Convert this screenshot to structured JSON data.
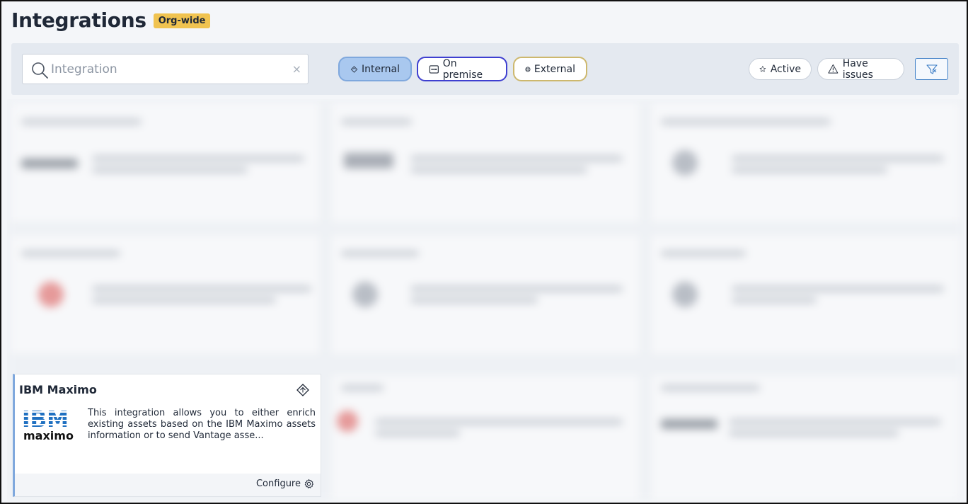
{
  "header": {
    "title": "Integrations",
    "badge": "Org-wide"
  },
  "toolbar": {
    "search": {
      "placeholder": "Integration",
      "value": "",
      "clear_icon": "×"
    },
    "type_filters": [
      {
        "label": "Internal",
        "icon": "diamond-icon",
        "selected": true,
        "color": "#a9c8ef"
      },
      {
        "label": "On premise",
        "icon": "server-icon",
        "selected": false,
        "color": "#3e3fd0"
      },
      {
        "label": "External",
        "icon": "globe-icon",
        "selected": false,
        "color": "#cdb86d"
      }
    ],
    "status_filters": [
      {
        "label": "Active",
        "icon": "star-icon"
      },
      {
        "label": "Have issues",
        "icon": "warning-icon"
      }
    ],
    "clear_filters_icon": "filter-clear-icon"
  },
  "cards": [
    {
      "name": "IBM Maximo",
      "logo": "ibm-maximo-logo",
      "logo_text": {
        "ibm": "IBM",
        "product": "maximo"
      },
      "description": "This integration allows you to either enrich existing assets based on the IBM Maximo assets information or to send Vantage asse...",
      "action": "Configure",
      "type_icon": "diamond-icon"
    }
  ],
  "colors": {
    "accent": "#3f7fc6",
    "badge": "#f0c350",
    "card_border": "#7fa8dd"
  }
}
